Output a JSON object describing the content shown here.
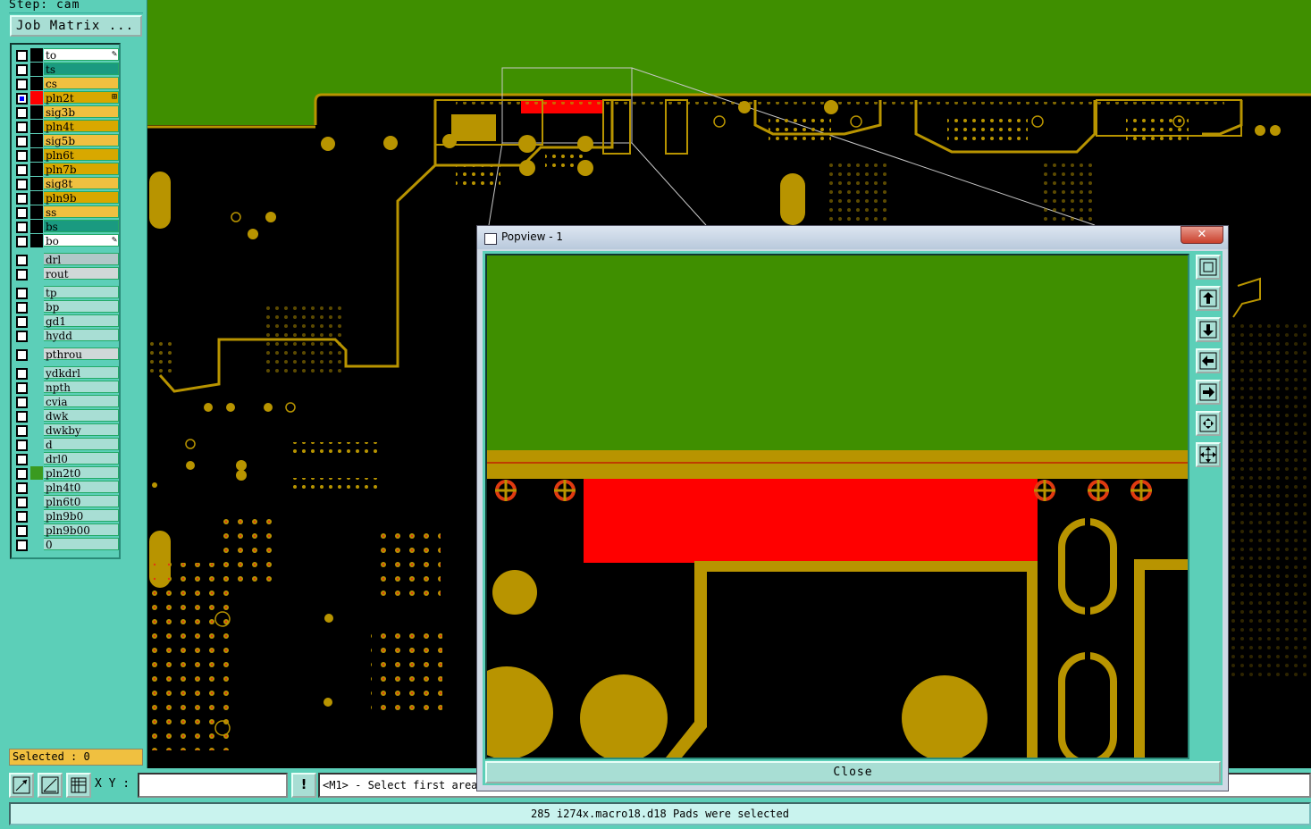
{
  "panel": {
    "step_label": "Step: cam",
    "job_matrix_label": "Job Matrix ...",
    "selected_label": "Selected : 0"
  },
  "layers": [
    {
      "name": "to",
      "bg": "#ffffff",
      "swatch": "#000000",
      "mark": "✎"
    },
    {
      "name": "ts",
      "bg": "#1a9a80",
      "swatch": "#000000",
      "mark": ""
    },
    {
      "name": "cs",
      "bg": "#f0c040",
      "swatch": "#000000",
      "mark": ""
    },
    {
      "name": "pln2t",
      "bg": "#d8a800",
      "swatch": "#ff0000",
      "mark": "⊞",
      "checked": true
    },
    {
      "name": "sig3b",
      "bg": "#f0c040",
      "swatch": "#000000",
      "mark": ""
    },
    {
      "name": "pln4t",
      "bg": "#d8a800",
      "swatch": "#000000",
      "mark": ""
    },
    {
      "name": "sig5b",
      "bg": "#f0c040",
      "swatch": "#000000",
      "mark": ""
    },
    {
      "name": "pln6t",
      "bg": "#d8a800",
      "swatch": "#000000",
      "mark": ""
    },
    {
      "name": "pln7b",
      "bg": "#d8a800",
      "swatch": "#000000",
      "mark": ""
    },
    {
      "name": "sig8t",
      "bg": "#f0c040",
      "swatch": "#000000",
      "mark": ""
    },
    {
      "name": "pln9b",
      "bg": "#d8a800",
      "swatch": "#000000",
      "mark": ""
    },
    {
      "name": "ss",
      "bg": "#f0c040",
      "swatch": "#000000",
      "mark": ""
    },
    {
      "name": "bs",
      "bg": "#1a9a80",
      "swatch": "#000000",
      "mark": ""
    },
    {
      "name": "bo",
      "bg": "#ffffff",
      "swatch": "#000000",
      "mark": "✎"
    },
    {
      "name": "drl",
      "bg": "#b0c8c8",
      "swatch": "#5ccfb8",
      "mark": ""
    },
    {
      "name": "rout",
      "bg": "#d0d8d8",
      "swatch": "#5ccfb8",
      "mark": ""
    },
    {
      "name": "tp",
      "bg": "#a8ded4",
      "swatch": "#5ccfb8",
      "mark": ""
    },
    {
      "name": "bp",
      "bg": "#a8ded4",
      "swatch": "#5ccfb8",
      "mark": ""
    },
    {
      "name": "gd1",
      "bg": "#a8ded4",
      "swatch": "#5ccfb8",
      "mark": ""
    },
    {
      "name": "hydd",
      "bg": "#a8ded4",
      "swatch": "#5ccfb8",
      "mark": ""
    },
    {
      "name": "pthrou",
      "bg": "#d0d8d8",
      "swatch": "#5ccfb8",
      "mark": ""
    },
    {
      "name": "ydkdrl",
      "bg": "#a8ded4",
      "swatch": "#5ccfb8",
      "mark": ""
    },
    {
      "name": "npth",
      "bg": "#a8ded4",
      "swatch": "#5ccfb8",
      "mark": ""
    },
    {
      "name": "cvia",
      "bg": "#a8ded4",
      "swatch": "#5ccfb8",
      "mark": ""
    },
    {
      "name": "dwk",
      "bg": "#a8ded4",
      "swatch": "#5ccfb8",
      "mark": ""
    },
    {
      "name": "dwkby",
      "bg": "#a8ded4",
      "swatch": "#5ccfb8",
      "mark": ""
    },
    {
      "name": "d",
      "bg": "#a8ded4",
      "swatch": "#5ccfb8",
      "mark": ""
    },
    {
      "name": "drl0",
      "bg": "#a8ded4",
      "swatch": "#5ccfb8",
      "mark": ""
    },
    {
      "name": "pln2t0",
      "bg": "#a8ded4",
      "swatch": "#3a9a20",
      "mark": ""
    },
    {
      "name": "pln4t0",
      "bg": "#a8ded4",
      "swatch": "#5ccfb8",
      "mark": ""
    },
    {
      "name": "pln6t0",
      "bg": "#a8ded4",
      "swatch": "#5ccfb8",
      "mark": ""
    },
    {
      "name": "pln9b0",
      "bg": "#a8ded4",
      "swatch": "#5ccfb8",
      "mark": ""
    },
    {
      "name": "pln9b00",
      "bg": "#a8ded4",
      "swatch": "#5ccfb8",
      "mark": ""
    },
    {
      "name": "0",
      "bg": "#a8ded4",
      "swatch": "#5ccfb8",
      "mark": ""
    }
  ],
  "bottom": {
    "xy_label": "X Y :",
    "xy_value": "",
    "warn_label": "!",
    "prompt": "<M1> - Select first area",
    "status": "285 i274x.macro18.d18 Pads were selected"
  },
  "popview": {
    "title": "Popview - 1",
    "close_x": "✕",
    "close_button": "Close"
  },
  "colors": {
    "panel": "#5ccfb8",
    "board_green": "#3f8f00",
    "copper": "#b89400",
    "selected_red": "#ff0000"
  }
}
